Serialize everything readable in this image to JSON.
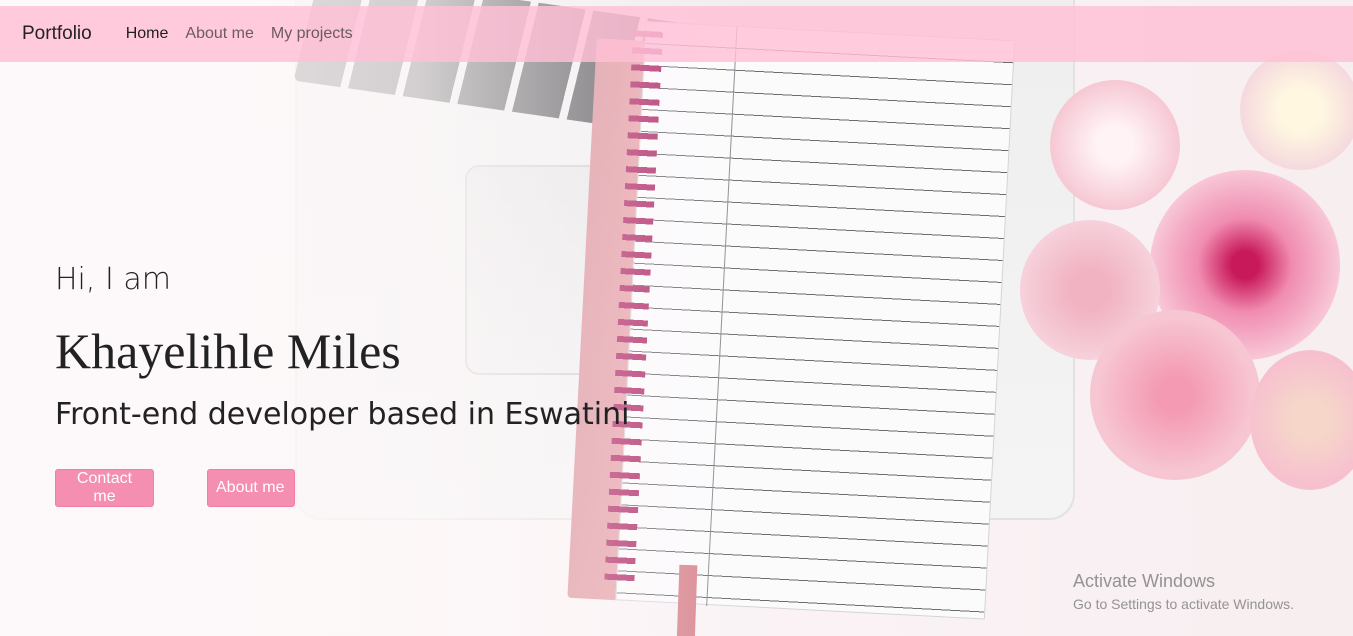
{
  "navbar": {
    "brand": "Portfolio",
    "links": [
      {
        "label": "Home",
        "active": true
      },
      {
        "label": "About me",
        "active": false
      },
      {
        "label": "My projects",
        "active": false
      }
    ]
  },
  "hero": {
    "greeting": "Hi, I am",
    "name": "Khayelihle Miles",
    "role": "Front-end developer based in Eswatini",
    "buttons": {
      "contact": "Contact me",
      "about": "About me"
    }
  },
  "watermark": {
    "title": "Activate Windows",
    "subtitle": "Go to Settings to activate Windows."
  },
  "colors": {
    "navbar": "#ffc0d5",
    "button": "#f48fb1",
    "text": "#222222"
  }
}
